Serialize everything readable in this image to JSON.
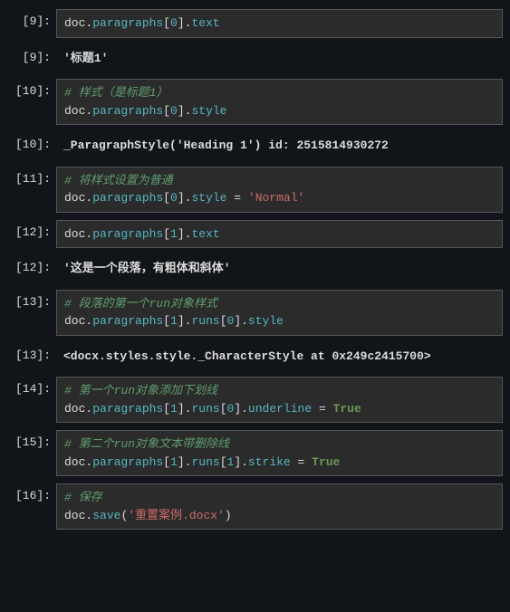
{
  "cells": [
    {
      "prompt": "[9]:",
      "type": "code",
      "tokens": [
        {
          "t": "var",
          "v": "doc"
        },
        {
          "t": "dot",
          "v": "."
        },
        {
          "t": "attr",
          "v": "paragraphs"
        },
        {
          "t": "br",
          "v": "["
        },
        {
          "t": "num",
          "v": "0"
        },
        {
          "t": "br",
          "v": "]."
        },
        {
          "t": "attr",
          "v": "text"
        }
      ]
    },
    {
      "prompt": "[9]:",
      "type": "output",
      "text": "'标题1'"
    },
    {
      "prompt": "[10]:",
      "type": "code",
      "tokens": [
        {
          "t": "comment",
          "v": "# 样式（是标题1）"
        },
        {
          "t": "nl"
        },
        {
          "t": "var",
          "v": "doc"
        },
        {
          "t": "dot",
          "v": "."
        },
        {
          "t": "attr",
          "v": "paragraphs"
        },
        {
          "t": "br",
          "v": "["
        },
        {
          "t": "num",
          "v": "0"
        },
        {
          "t": "br",
          "v": "]."
        },
        {
          "t": "attr",
          "v": "style"
        }
      ]
    },
    {
      "prompt": "[10]:",
      "type": "output",
      "text": "_ParagraphStyle('Heading 1') id: 2515814930272"
    },
    {
      "prompt": "[11]:",
      "type": "code",
      "tokens": [
        {
          "t": "comment",
          "v": "# 将样式设置为普通"
        },
        {
          "t": "nl"
        },
        {
          "t": "var",
          "v": "doc"
        },
        {
          "t": "dot",
          "v": "."
        },
        {
          "t": "attr",
          "v": "paragraphs"
        },
        {
          "t": "br",
          "v": "["
        },
        {
          "t": "num",
          "v": "0"
        },
        {
          "t": "br",
          "v": "]."
        },
        {
          "t": "attr",
          "v": "style"
        },
        {
          "t": "op",
          "v": " = "
        },
        {
          "t": "str",
          "v": "'Normal'"
        }
      ]
    },
    {
      "prompt": "[12]:",
      "type": "code",
      "tokens": [
        {
          "t": "var",
          "v": "doc"
        },
        {
          "t": "dot",
          "v": "."
        },
        {
          "t": "attr",
          "v": "paragraphs"
        },
        {
          "t": "br",
          "v": "["
        },
        {
          "t": "num",
          "v": "1"
        },
        {
          "t": "br",
          "v": "]."
        },
        {
          "t": "attr",
          "v": "text"
        }
      ]
    },
    {
      "prompt": "[12]:",
      "type": "output",
      "text": "'这是一个段落，有粗体和斜体'"
    },
    {
      "prompt": "[13]:",
      "type": "code",
      "tokens": [
        {
          "t": "comment",
          "v": "# 段落的第一个run对象样式"
        },
        {
          "t": "nl"
        },
        {
          "t": "var",
          "v": "doc"
        },
        {
          "t": "dot",
          "v": "."
        },
        {
          "t": "attr",
          "v": "paragraphs"
        },
        {
          "t": "br",
          "v": "["
        },
        {
          "t": "num",
          "v": "1"
        },
        {
          "t": "br",
          "v": "]."
        },
        {
          "t": "attr",
          "v": "runs"
        },
        {
          "t": "br",
          "v": "["
        },
        {
          "t": "num",
          "v": "0"
        },
        {
          "t": "br",
          "v": "]."
        },
        {
          "t": "attr",
          "v": "style"
        }
      ]
    },
    {
      "prompt": "[13]:",
      "type": "output",
      "text": "<docx.styles.style._CharacterStyle at 0x249c2415700>"
    },
    {
      "prompt": "[14]:",
      "type": "code",
      "tokens": [
        {
          "t": "comment",
          "v": "# 第一个run对象添加下划线"
        },
        {
          "t": "nl"
        },
        {
          "t": "var",
          "v": "doc"
        },
        {
          "t": "dot",
          "v": "."
        },
        {
          "t": "attr",
          "v": "paragraphs"
        },
        {
          "t": "br",
          "v": "["
        },
        {
          "t": "num",
          "v": "1"
        },
        {
          "t": "br",
          "v": "]."
        },
        {
          "t": "attr",
          "v": "runs"
        },
        {
          "t": "br",
          "v": "["
        },
        {
          "t": "num",
          "v": "0"
        },
        {
          "t": "br",
          "v": "]."
        },
        {
          "t": "attr",
          "v": "underline"
        },
        {
          "t": "op",
          "v": " = "
        },
        {
          "t": "bool",
          "v": "True"
        }
      ]
    },
    {
      "prompt": "[15]:",
      "type": "code",
      "tokens": [
        {
          "t": "comment",
          "v": "# 第二个run对象文本带删除线"
        },
        {
          "t": "nl"
        },
        {
          "t": "var",
          "v": "doc"
        },
        {
          "t": "dot",
          "v": "."
        },
        {
          "t": "attr",
          "v": "paragraphs"
        },
        {
          "t": "br",
          "v": "["
        },
        {
          "t": "num",
          "v": "1"
        },
        {
          "t": "br",
          "v": "]."
        },
        {
          "t": "attr",
          "v": "runs"
        },
        {
          "t": "br",
          "v": "["
        },
        {
          "t": "num",
          "v": "1"
        },
        {
          "t": "br",
          "v": "]."
        },
        {
          "t": "attr",
          "v": "strike"
        },
        {
          "t": "op",
          "v": " = "
        },
        {
          "t": "bool",
          "v": "True"
        }
      ]
    },
    {
      "prompt": "[16]:",
      "type": "code",
      "tokens": [
        {
          "t": "comment",
          "v": "# 保存"
        },
        {
          "t": "nl"
        },
        {
          "t": "var",
          "v": "doc"
        },
        {
          "t": "dot",
          "v": "."
        },
        {
          "t": "func",
          "v": "save"
        },
        {
          "t": "br",
          "v": "("
        },
        {
          "t": "str",
          "v": "'重置案例.docx'"
        },
        {
          "t": "br",
          "v": ")"
        }
      ]
    }
  ]
}
